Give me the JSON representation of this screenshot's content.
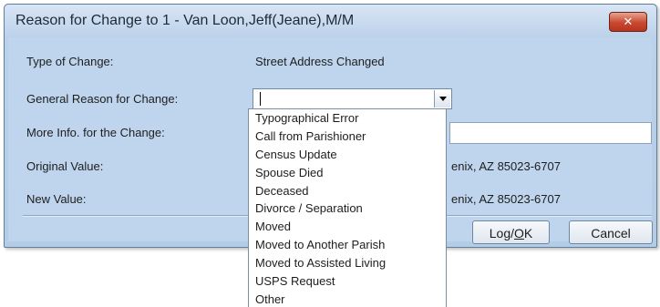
{
  "dialog": {
    "title": "Reason for Change to 1 - Van Loon,Jeff(Jeane),M/M",
    "close_label": "✕"
  },
  "form": {
    "type_label": "Type of Change:",
    "type_value": "Street Address Changed",
    "reason_label": "General Reason for Change:",
    "reason_value": "",
    "more_info_label": "More Info. for the Change:",
    "more_info_value": "",
    "original_label": "Original Value:",
    "original_value_visible": "enix, AZ  85023-6707",
    "new_label": "New Value:",
    "new_value_visible": "enix, AZ  85023-6707"
  },
  "buttons": {
    "ok_prefix": "Log/",
    "ok_mnemonic": "O",
    "ok_suffix": "K",
    "cancel_label": "Cancel"
  },
  "dropdown": {
    "options": [
      "Typographical Error",
      "Call from Parishioner",
      "Census Update",
      "Spouse Died",
      "Deceased",
      "Divorce / Separation",
      "Moved",
      "Moved to Another Parish",
      "Moved to Assisted Living",
      "USPS Request",
      "Other"
    ]
  }
}
